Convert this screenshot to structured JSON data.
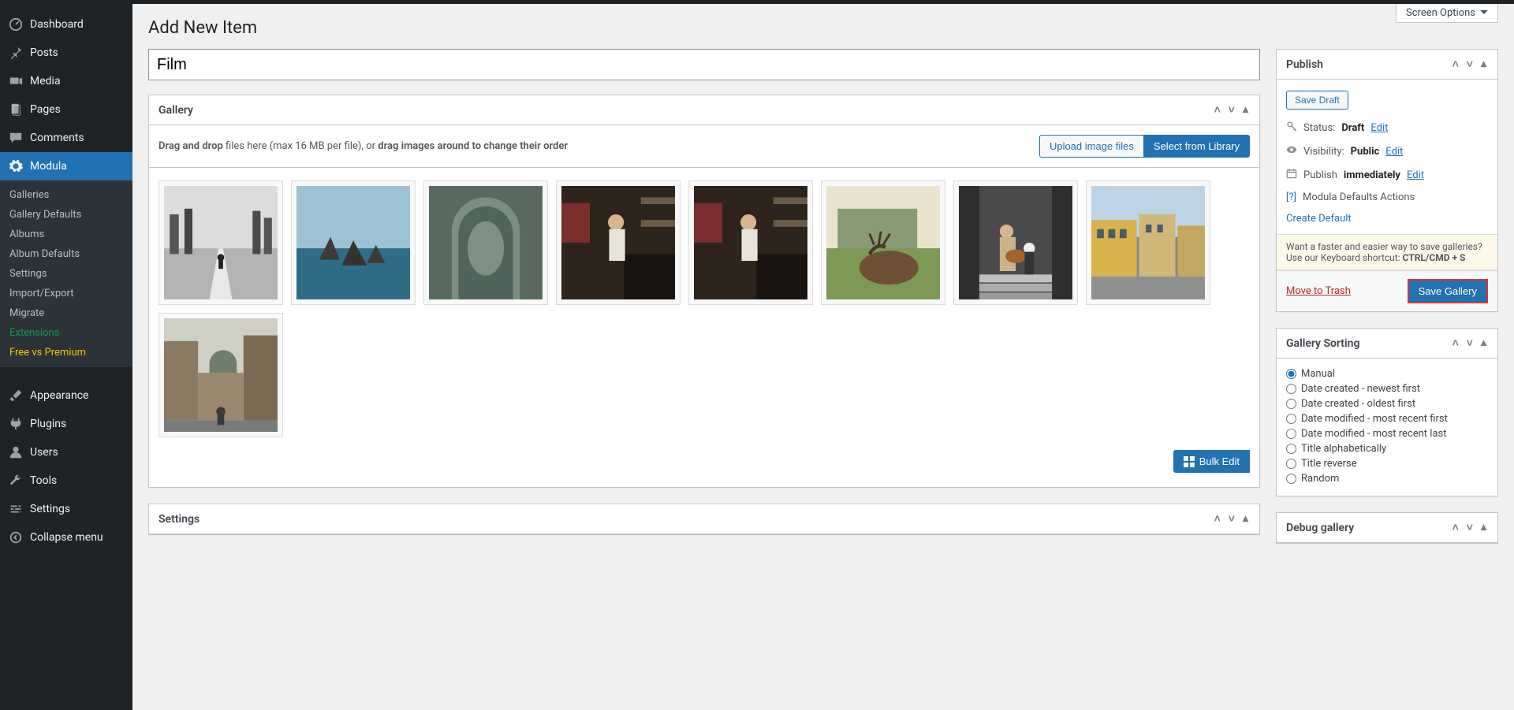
{
  "screen_options": "Screen Options",
  "page_title": "Add New Item",
  "title_value": "Film",
  "sidebar": {
    "items": [
      {
        "label": "Dashboard"
      },
      {
        "label": "Posts"
      },
      {
        "label": "Media"
      },
      {
        "label": "Pages"
      },
      {
        "label": "Comments"
      },
      {
        "label": "Modula"
      },
      {
        "label": "Appearance"
      },
      {
        "label": "Plugins"
      },
      {
        "label": "Users"
      },
      {
        "label": "Tools"
      },
      {
        "label": "Settings"
      },
      {
        "label": "Collapse menu"
      }
    ],
    "sub": [
      "Galleries",
      "Gallery Defaults",
      "Albums",
      "Album Defaults",
      "Settings",
      "Import/Export",
      "Migrate",
      "Extensions",
      "Free vs Premium"
    ]
  },
  "gallery_box": {
    "title": "Gallery",
    "drag_prefix": "Drag and drop",
    "drag_middle": " files here (max 16 MB per file), or ",
    "drag_bold2": "drag images around to change their order",
    "upload_btn": "Upload image files",
    "select_btn": "Select from Library",
    "bulk_edit": "Bulk Edit"
  },
  "settings_box_title": "Settings",
  "publish": {
    "title": "Publish",
    "save_draft": "Save Draft",
    "status_label": "Status:",
    "status_value": "Draft",
    "visibility_label": "Visibility:",
    "visibility_value": "Public",
    "publish_label": "Publish",
    "publish_value": "immediately",
    "edit": "Edit",
    "defaults_actions": "Modula Defaults Actions",
    "create_default": "Create Default",
    "tip_prefix": "Want a faster and easier way to save galleries? Use our Keyboard shortcut: ",
    "tip_shortcut": "CTRL/CMD + S",
    "trash": "Move to Trash",
    "save_gallery": "Save Gallery"
  },
  "sorting": {
    "title": "Gallery Sorting",
    "options": [
      "Manual",
      "Date created - newest first",
      "Date created - oldest first",
      "Date modified - most recent first",
      "Date modified - most recent last",
      "Title alphabetically",
      "Title reverse",
      "Random"
    ],
    "selected_index": 0
  },
  "debug_title": "Debug gallery"
}
